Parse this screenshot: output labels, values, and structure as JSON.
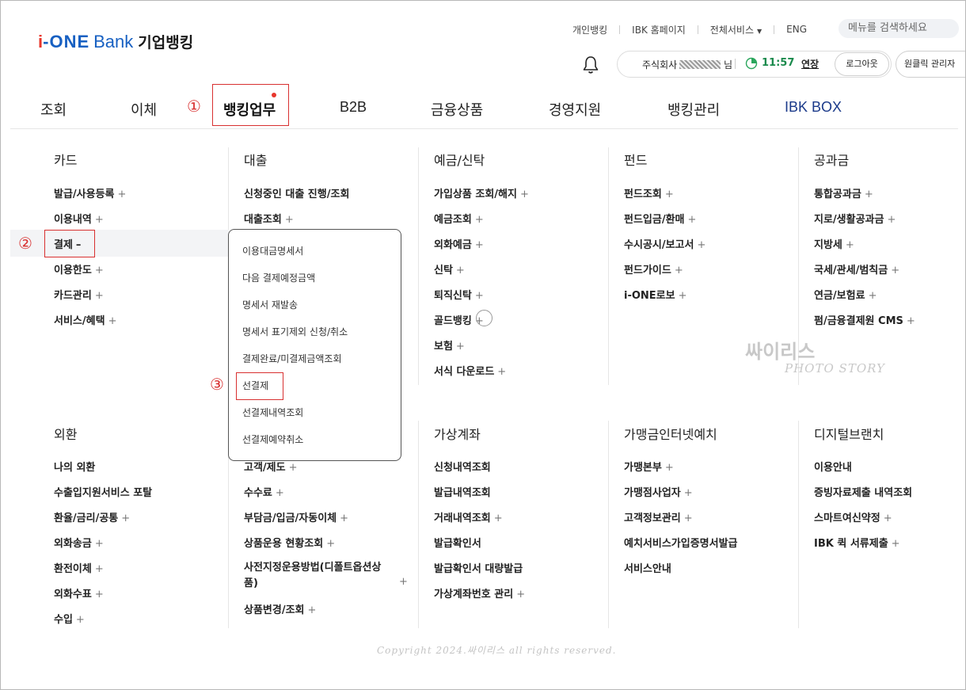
{
  "logo": {
    "i": "i",
    "one": "-ONE",
    "bank": "Bank",
    "kr": "기업뱅킹"
  },
  "top_links": [
    "개인뱅킹",
    "IBK 홈페이지",
    "전체서비스",
    "ENG"
  ],
  "search": {
    "placeholder": "메뉴를 검색하세요"
  },
  "user": {
    "company": "주식회사",
    "suffix": "님",
    "time": "11:57",
    "extend": "연장",
    "logout": "로그아웃",
    "one_click": "원클릭 관리자"
  },
  "gnb": [
    "조회",
    "이체",
    "뱅킹업무",
    "B2B",
    "금융상품",
    "경영지원",
    "뱅킹관리",
    "IBK BOX"
  ],
  "annotations": [
    "①",
    "②",
    "③"
  ],
  "columns": {
    "card": {
      "title": "카드",
      "items": [
        "발급/사용등록",
        "이용내역",
        "결제",
        "이용한도",
        "카드관리",
        "서비스/혜택"
      ]
    },
    "loan": {
      "title": "대출",
      "items": [
        "신청중인 대출 진행/조회",
        "대출조회"
      ]
    },
    "deposit": {
      "title": "예금/신탁",
      "items": [
        "가입상품 조회/해지",
        "예금조회",
        "외화예금",
        "신탁",
        "퇴직신탁",
        "골드뱅킹",
        "보험",
        "서식 다운로드"
      ]
    },
    "fund": {
      "title": "펀드",
      "items": [
        "펀드조회",
        "펀드입금/환매",
        "수시공시/보고서",
        "펀드가이드",
        "i-ONE로보"
      ]
    },
    "tax": {
      "title": "공과금",
      "items": [
        "통합공과금",
        "지로/생활공과금",
        "지방세",
        "국세/관세/범칙금",
        "연금/보험료",
        "펌/금융결제원 CMS"
      ]
    },
    "fx": {
      "title": "외환",
      "items": [
        "나의 외환",
        "수출입지원서비스 포탈",
        "환율/금리/공통",
        "외화송금",
        "환전이체",
        "외화수표",
        "수입"
      ]
    },
    "loan2": {
      "items": [
        "고객/제도",
        "수수료",
        "부담금/입금/자동이체",
        "상품운용 현황조회",
        "사전지정운용방법(디폴트옵션상품)",
        "상품변경/조회"
      ]
    },
    "virtual": {
      "title": "가상계좌",
      "items": [
        "신청내역조회",
        "발급내역조회",
        "거래내역조회",
        "발급확인서",
        "발급확인서 대량발급",
        "가상계좌번호 관리"
      ]
    },
    "merchant": {
      "title": "가맹금인터넷예치",
      "items": [
        "가맹본부",
        "가맹점사업자",
        "고객정보관리",
        "예치서비스가입증명서발급",
        "서비스안내"
      ]
    },
    "digital": {
      "title": "디지털브랜치",
      "items": [
        "이용안내",
        "증빙자료제출 내역조회",
        "스마트여신약정",
        "IBK 퀵 서류제출"
      ]
    }
  },
  "submenu": [
    "이용대금명세서",
    "다음 결제예정금액",
    "명세서 재발송",
    "명세서 표기제외 신청/취소",
    "결제완료/미결제금액조회",
    "선결제",
    "선결제내역조회",
    "선결제예약취소"
  ],
  "watermark": {
    "line1": "싸이리스",
    "line2": "PHOTO STORY"
  },
  "copyright": "Copyright 2024.싸이리스 all rights reserved.",
  "colors": {
    "brand_blue": "#1760c2",
    "brand_red": "#e8362c",
    "annotation_red": "#d83030",
    "timer_green": "#1a8a4c"
  }
}
